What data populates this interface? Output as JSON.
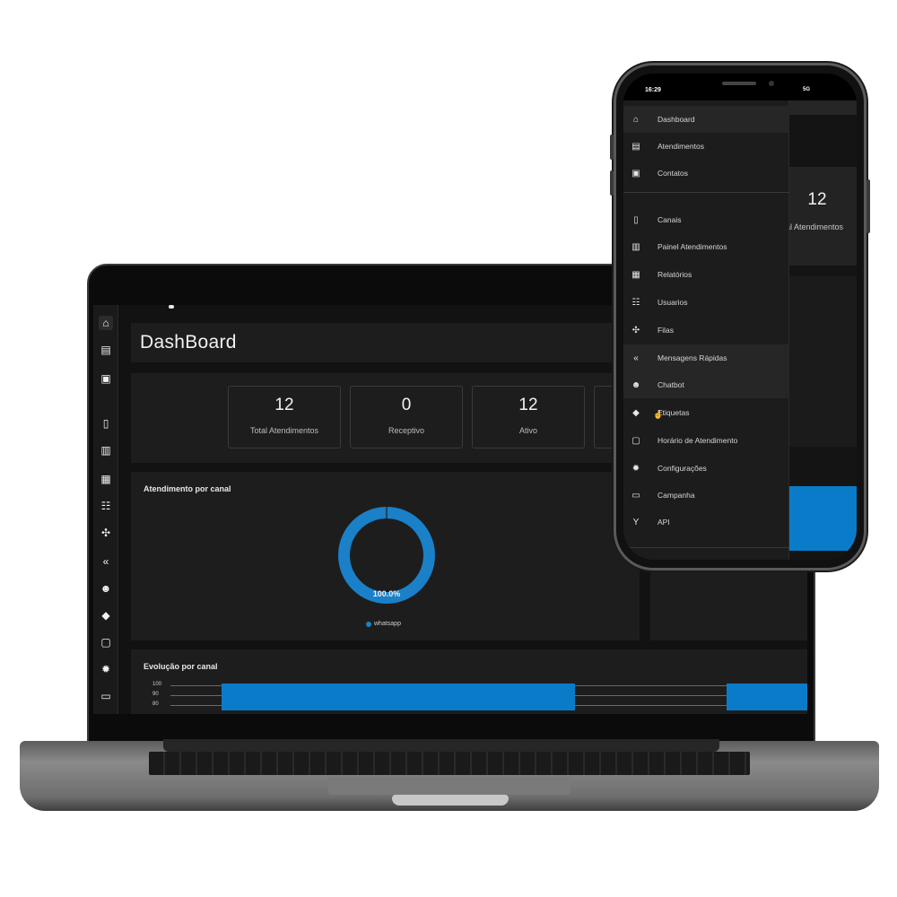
{
  "laptop": {
    "page_title": "DashBoard",
    "rail_icons": [
      "home-icon",
      "chat-icon",
      "contact-card-icon",
      "phone-signal-icon",
      "kanban-icon",
      "report-icon",
      "users-icon",
      "queue-icon",
      "quick-reply-icon",
      "robot-icon",
      "tag-icon",
      "calendar-icon",
      "gear-icon",
      "campaign-icon"
    ],
    "stats": [
      {
        "value": "12",
        "label": "Total Atendimentos"
      },
      {
        "value": "0",
        "label": "Receptivo"
      },
      {
        "value": "12",
        "label": "Ativo"
      }
    ],
    "channel_chart": {
      "title": "Atendimento por canal",
      "center_label": "100.0%",
      "legend": "whatsapp"
    },
    "evolution_chart": {
      "title": "Evolução por canal",
      "ticks": [
        "100",
        "90",
        "80"
      ]
    }
  },
  "chart_data": [
    {
      "type": "pie",
      "title": "Atendimento por canal",
      "categories": [
        "whatsapp"
      ],
      "values": [
        100.0
      ],
      "colors": [
        "#0a7bc9"
      ]
    },
    {
      "type": "bar",
      "title": "Evolução por canal",
      "ylim": [
        80,
        100
      ],
      "ticks": [
        100,
        90,
        80
      ],
      "color": "#0a7bc9"
    }
  ],
  "phone": {
    "status_time": "16:29",
    "status_signal": "5G",
    "menu": [
      {
        "icon": "home-icon",
        "glyph": "⌂",
        "label": "Dashboard"
      },
      {
        "icon": "chat-icon",
        "glyph": "▤",
        "label": "Atendimentos"
      },
      {
        "icon": "contact-card-icon",
        "glyph": "▣",
        "label": "Contatos"
      },
      {
        "icon": "phone-signal-icon",
        "glyph": "▯",
        "label": "Canais"
      },
      {
        "icon": "kanban-icon",
        "glyph": "▥",
        "label": "Painel Atendimentos"
      },
      {
        "icon": "report-icon",
        "glyph": "▦",
        "label": "Relatórios"
      },
      {
        "icon": "users-icon",
        "glyph": "☷",
        "label": "Usuarios"
      },
      {
        "icon": "queue-icon",
        "glyph": "✣",
        "label": "Filas"
      },
      {
        "icon": "quick-reply-icon",
        "glyph": "«",
        "label": "Mensagens Rápidas"
      },
      {
        "icon": "robot-icon",
        "glyph": "☻",
        "label": "Chatbot"
      },
      {
        "icon": "tag-icon",
        "glyph": "◆",
        "label": "Etiquetas"
      },
      {
        "icon": "calendar-icon",
        "glyph": "▢",
        "label": "Horário de Atendimento"
      },
      {
        "icon": "gear-icon",
        "glyph": "✹",
        "label": "Configurações"
      },
      {
        "icon": "campaign-icon",
        "glyph": "▭",
        "label": "Campanha"
      },
      {
        "icon": "api-icon",
        "glyph": "Y",
        "label": "API"
      }
    ],
    "bg_stat_value": "12",
    "bg_stat_label": "al Atendimentos"
  }
}
